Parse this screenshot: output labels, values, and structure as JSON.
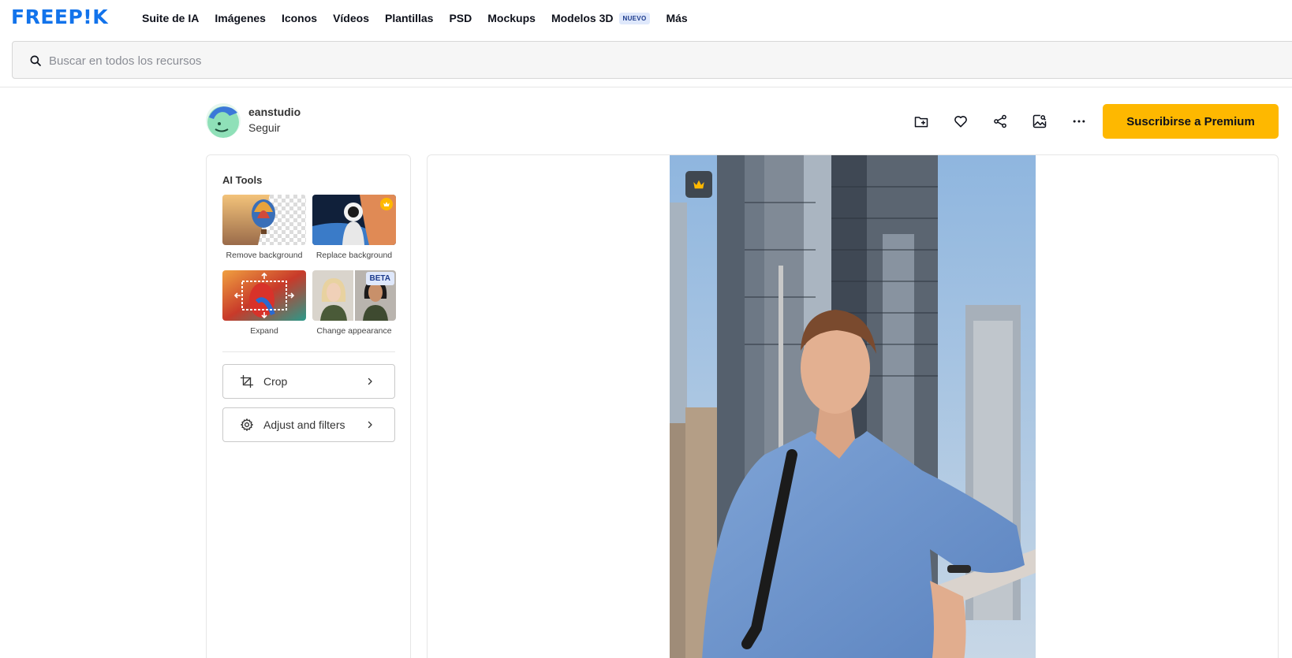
{
  "nav": {
    "logo_text": "FREEP!K",
    "items": [
      "Suite de IA",
      "Imágenes",
      "Iconos",
      "Vídeos",
      "Plantillas",
      "PSD",
      "Mockups",
      "Modelos 3D",
      "Más"
    ],
    "new_badge": "NUEVO"
  },
  "search": {
    "placeholder": "Buscar en todos los recursos",
    "icon": "search-icon"
  },
  "author": {
    "name": "eanstudio",
    "follow_label": "Seguir"
  },
  "actions": {
    "icons": [
      "add-to-collection-icon",
      "heart-icon",
      "share-icon",
      "image-search-icon",
      "more-icon"
    ],
    "premium_label": "Suscribirse a Premium",
    "premium_color": "#feb800"
  },
  "ai_tools": {
    "title": "AI Tools",
    "tools": [
      {
        "label": "Remove background"
      },
      {
        "label": "Replace background"
      },
      {
        "label": "Expand"
      },
      {
        "label": "Change appearance"
      }
    ],
    "beta_label": "BETA",
    "crop_label": "Crop",
    "adjust_label": "Adjust and filters"
  },
  "brand_color": "#1273eb"
}
